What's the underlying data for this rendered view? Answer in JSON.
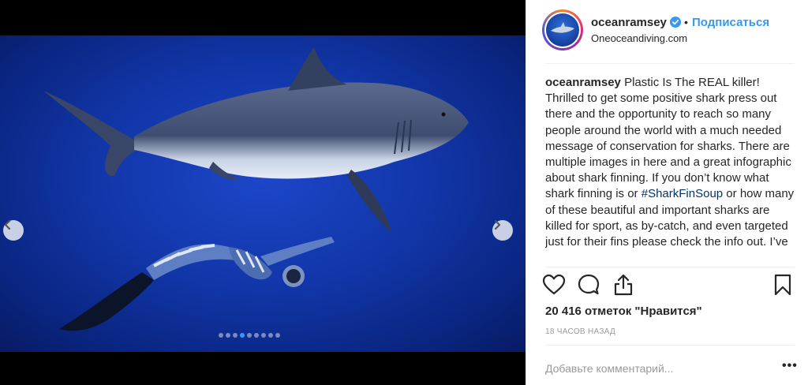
{
  "post": {
    "username": "oceanramsey",
    "verified": true,
    "follow_label": "Подписаться",
    "separator": "•",
    "location": "Oneoceandiving.com"
  },
  "media": {
    "dots_count": 9,
    "active_dot_index": 3
  },
  "caption": {
    "user": "oceanramsey",
    "text_before_hashtag": " Plastic Is The REAL killer! Thrilled to get some positive shark press out there and the opportunity to reach so many people around the world with a much needed message of conservation for sharks.  There are multiple images in here and a great infographic about shark finning. If you don’t know what shark finning is or ",
    "hashtag": "#SharkFinSoup",
    "text_after_hashtag": " or how many of these beautiful and important sharks are killed for sport, as by-catch, and even targeted just for their fins please check the info out. I’ve"
  },
  "engagement": {
    "likes_text": "20 416 отметок \"Нравится\"",
    "time_ago": "18 ЧАСОВ НАЗАД"
  },
  "comment": {
    "placeholder": "Добавьте комментарий...",
    "more_label": "•••"
  },
  "colors": {
    "accent": "#3897f0",
    "hashtag": "#003569",
    "ocean": "#1136a8"
  }
}
